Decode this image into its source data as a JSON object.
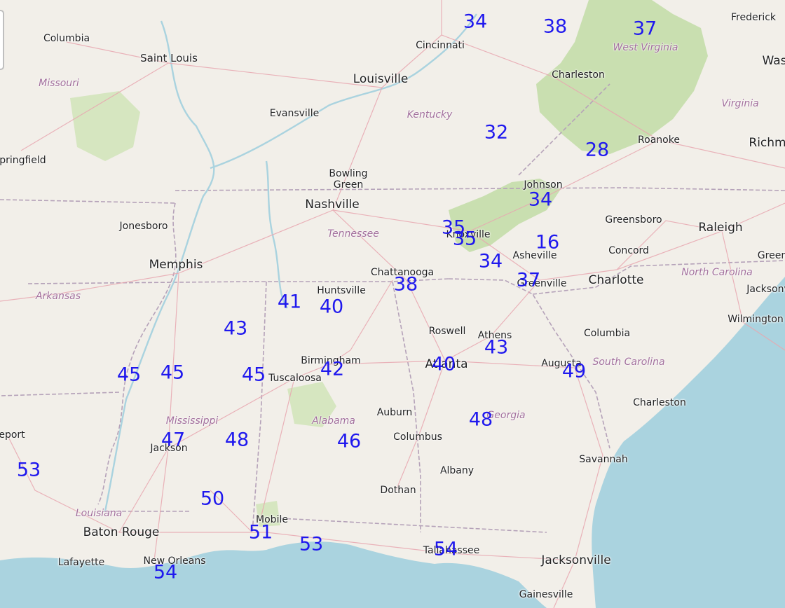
{
  "map": {
    "colors": {
      "land": "#f2efe9",
      "water": "#aad3df",
      "forest": "#c9dfb0",
      "road": "#e8a7b0",
      "border": "#b5a2b9",
      "value_text": "#1f18ee"
    },
    "states": [
      "Missouri",
      "Kentucky",
      "West Virginia",
      "Virginia",
      "Tennessee",
      "North Carolina",
      "Arkansas",
      "Mississippi",
      "Alabama",
      "South Carolina",
      "Georgia",
      "Louisiana"
    ],
    "cities": [
      "Columbia",
      "Saint Louis",
      "Cincinnati",
      "Frederick",
      "Louisville",
      "Charleston",
      "Evansville",
      "Springfield",
      "Roanoke",
      "Richm",
      "Bowling Green",
      "Johnson",
      "Nashville",
      "Jonesboro",
      "Greensboro",
      "Raleigh",
      "Knoxville",
      "Asheville",
      "Concord",
      "Green",
      "Memphis",
      "Chattanooga",
      "Charlotte",
      "Greenville",
      "Huntsville",
      "Jacksonv",
      "Roswell",
      "Athens",
      "Columbia",
      "Wilmington",
      "Birmingham",
      "Atlanta",
      "Augusta",
      "Tuscaloosa",
      "Charleston",
      "Auburn",
      "Columbus",
      "Jackson",
      "Savannah",
      "Albany",
      "Dothan",
      "Mobile",
      "Baton Rouge",
      "Tallahassee",
      "Lafayette",
      "New Orleans",
      "Jacksonville",
      "Gainesville",
      "eport",
      "Was"
    ],
    "values": [
      "34",
      "38",
      "37",
      "32",
      "28",
      "34",
      "35",
      "35",
      "16",
      "34",
      "37",
      "38",
      "41",
      "40",
      "43",
      "43",
      "45",
      "45",
      "45",
      "42",
      "40",
      "49",
      "48",
      "47",
      "48",
      "46",
      "53",
      "50",
      "51",
      "53",
      "54",
      "54"
    ]
  }
}
